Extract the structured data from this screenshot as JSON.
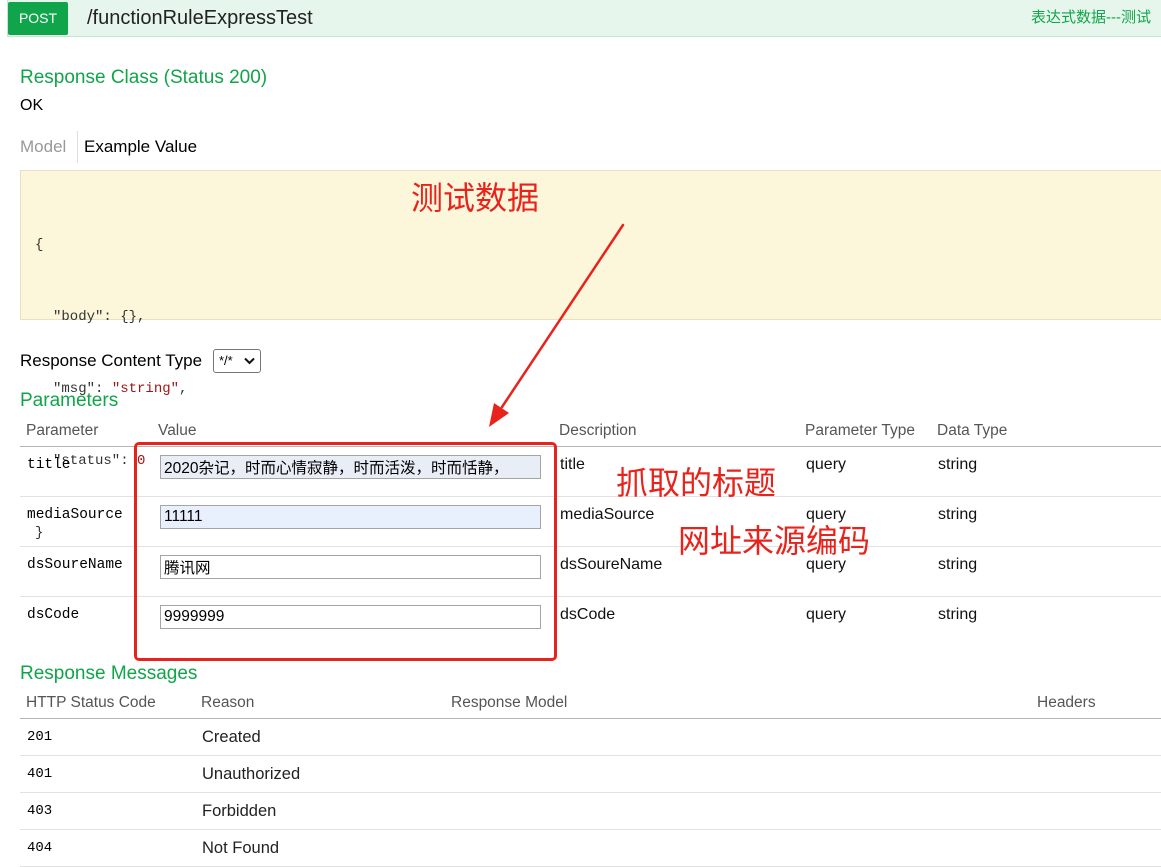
{
  "theme": {
    "post": "#10a54a",
    "header_bg": "#e7f6ec",
    "header_border": "#c3e8d1",
    "heading_green": "#10a54a",
    "example_bg": "#fcf6db",
    "example_border": "#e5e0c6",
    "string_value": "#a31515",
    "annotation_red": "#e8231c"
  },
  "operation": {
    "method": "POST",
    "path": "/functionRuleExpressTest",
    "summary": "表达式数据---测试"
  },
  "response_class": {
    "heading": "Response Class (Status 200)",
    "description": "OK",
    "tabs": [
      {
        "label": "Model",
        "active": false
      },
      {
        "label": "Example Value",
        "active": true
      }
    ],
    "example_value": {
      "open": "{",
      "fields": [
        {
          "key": "\"body\"",
          "colon": ": ",
          "value": "{}",
          "comma": ","
        },
        {
          "key": "\"msg\"",
          "colon": ": ",
          "value": "\"string\"",
          "comma": ","
        },
        {
          "key": "\"status\"",
          "colon": ": ",
          "value": "0",
          "comma": ""
        }
      ],
      "close": "}"
    }
  },
  "response_content_type": {
    "label": "Response Content Type",
    "selected": "*/*",
    "icon": "chevron-down-icon"
  },
  "parameters": {
    "heading": "Parameters",
    "columns": [
      "Parameter",
      "Value",
      "Description",
      "Parameter Type",
      "Data Type"
    ],
    "rows": [
      {
        "name": "title",
        "value": "2020杂记，时而心情寂静，时而活泼，时而恬静，",
        "description": "title",
        "param_type": "query",
        "data_type": "string"
      },
      {
        "name": "mediaSource",
        "value": "11111",
        "description": "mediaSource",
        "param_type": "query",
        "data_type": "string"
      },
      {
        "name": "dsSoureName",
        "value": "腾讯网",
        "description": "dsSoureName",
        "param_type": "query",
        "data_type": "string"
      },
      {
        "name": "dsCode",
        "value": "9999999",
        "description": "dsCode",
        "param_type": "query",
        "data_type": "string"
      }
    ]
  },
  "response_messages": {
    "heading": "Response Messages",
    "columns": [
      "HTTP Status Code",
      "Reason",
      "Response Model",
      "Headers"
    ],
    "rows": [
      {
        "code": "201",
        "reason": "Created"
      },
      {
        "code": "401",
        "reason": "Unauthorized"
      },
      {
        "code": "403",
        "reason": "Forbidden"
      },
      {
        "code": "404",
        "reason": "Not Found"
      }
    ]
  },
  "annotations": {
    "test_data": "测试数据",
    "scraped_title": "抓取的标题",
    "source_code": "网址来源编码"
  }
}
